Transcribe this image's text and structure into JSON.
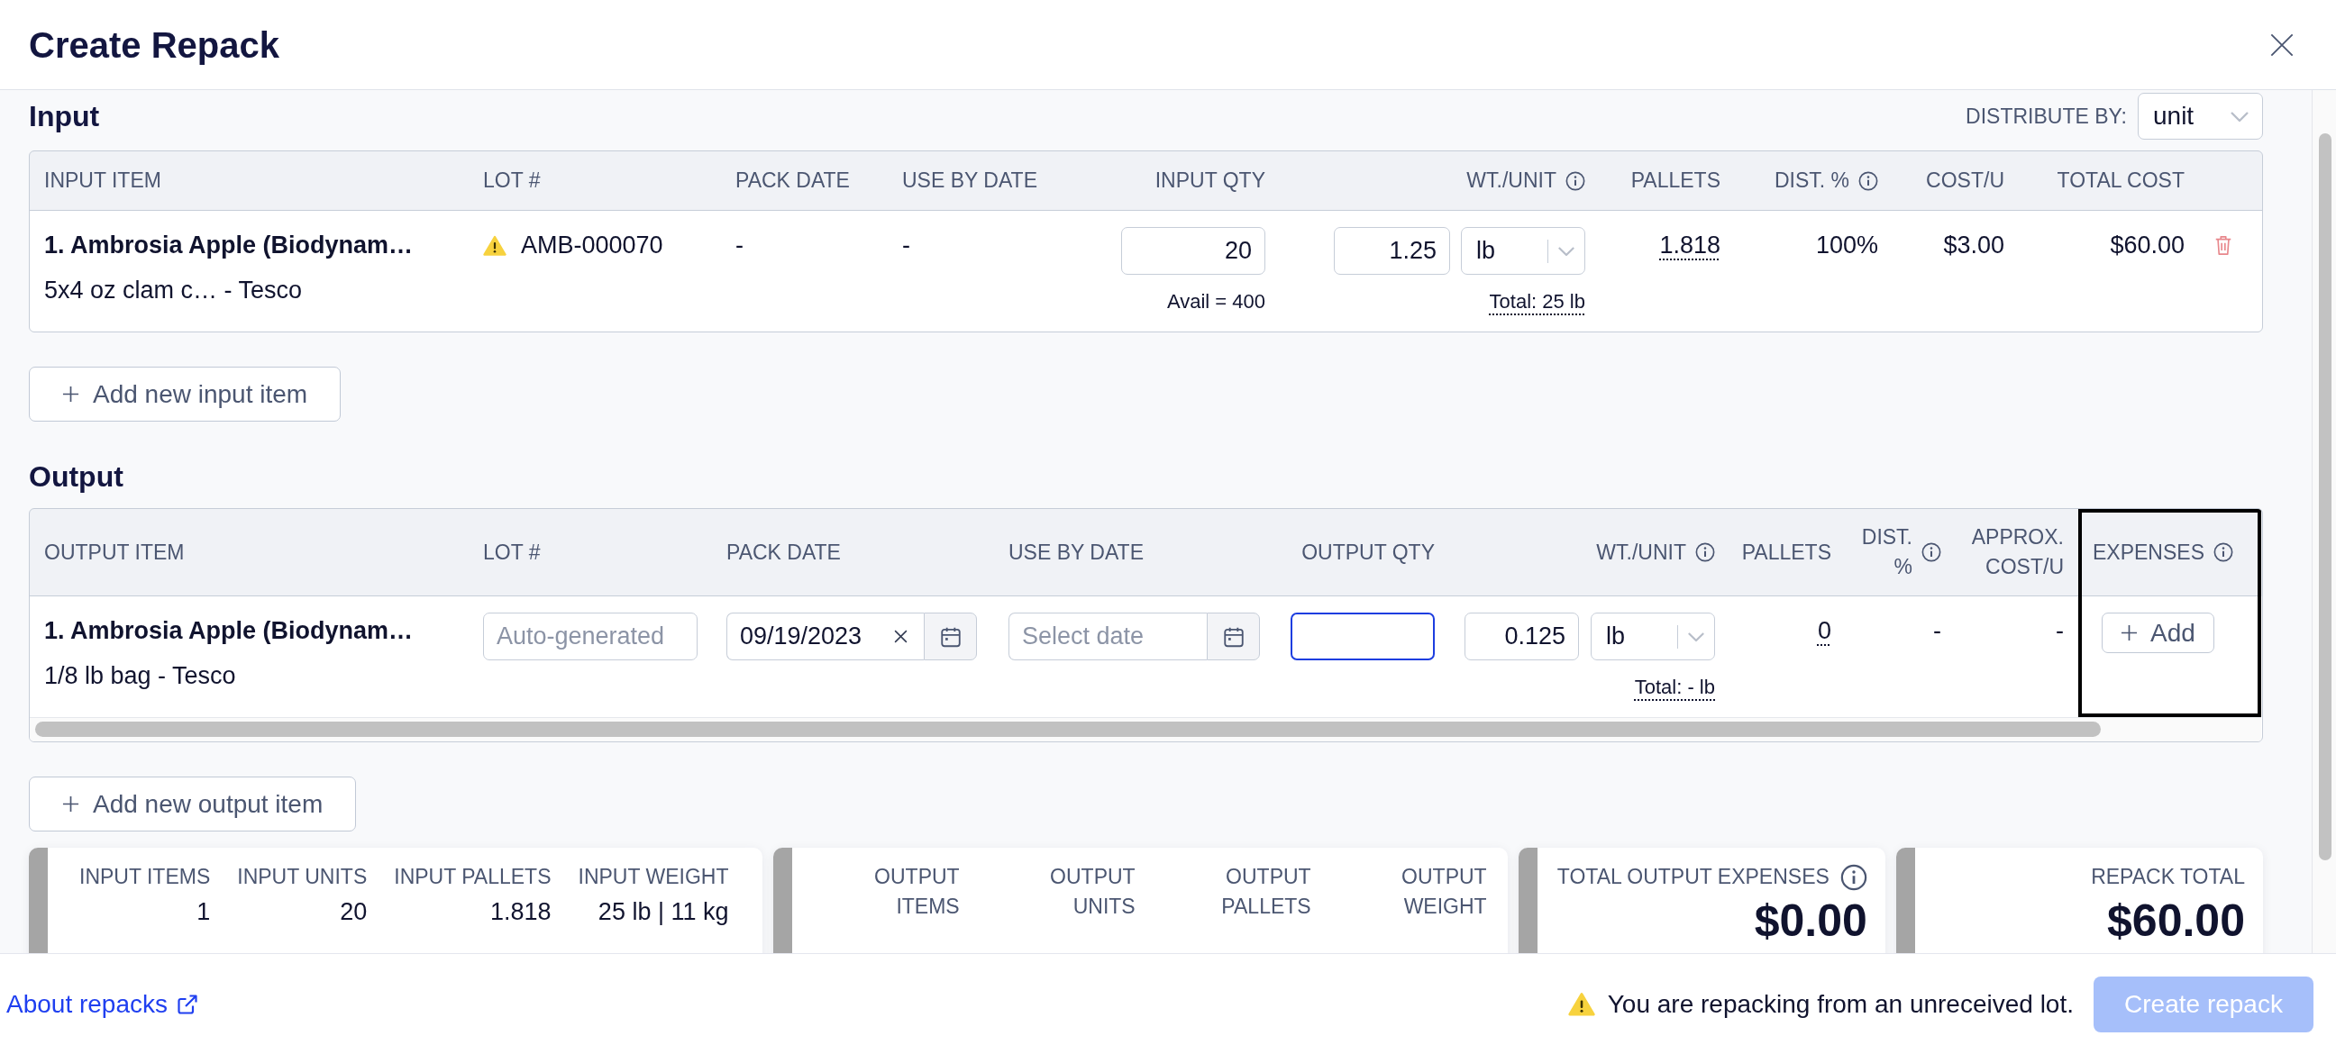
{
  "modal": {
    "title": "Create Repack"
  },
  "input": {
    "heading": "Input",
    "distribute_by": {
      "label": "DISTRIBUTE BY:",
      "value": "unit"
    },
    "columns": [
      {
        "label": "INPUT ITEM",
        "info": false
      },
      {
        "label": "LOT #",
        "info": false
      },
      {
        "label": "PACK DATE",
        "info": false
      },
      {
        "label": "USE BY DATE",
        "info": false
      },
      {
        "label": "INPUT QTY",
        "info": false
      },
      {
        "label": "WT./UNIT",
        "info": true
      },
      {
        "label": "PALLETS",
        "info": false
      },
      {
        "label": "DIST. %",
        "info": true
      },
      {
        "label": "COST/U",
        "info": false
      },
      {
        "label": "TOTAL COST",
        "info": false
      }
    ],
    "rows": [
      {
        "name": "1. Ambrosia Apple (Biodynam…",
        "description": "5x4 oz clam c… - Tesco",
        "lot": "AMB-000070",
        "lot_warning": true,
        "pack_date": "-",
        "use_by_date": "-",
        "quantity": "20",
        "available": "Avail = 400",
        "weight": "1.25",
        "unit": "lb",
        "total_weight": "Total: 25 lb",
        "pallets": "1.818",
        "distribution": "100%",
        "cost_per_unit": "$3.00",
        "total_cost": "$60.00"
      }
    ],
    "add_button": "Add new input item"
  },
  "output": {
    "heading": "Output",
    "columns": [
      {
        "label": "OUTPUT ITEM",
        "info": false,
        "highlighted": false
      },
      {
        "label": "LOT #",
        "info": false,
        "highlighted": false
      },
      {
        "label": "PACK DATE",
        "info": false,
        "highlighted": false
      },
      {
        "label": "USE BY DATE",
        "info": false,
        "highlighted": false
      },
      {
        "label": "OUTPUT QTY",
        "info": false,
        "highlighted": false
      },
      {
        "label": "WT./UNIT",
        "info": true,
        "highlighted": false
      },
      {
        "label": "PALLETS",
        "info": false,
        "highlighted": false
      },
      {
        "label": "DIST. %",
        "info": true,
        "highlighted": false
      },
      {
        "label": "APPROX. COST/U",
        "info": false,
        "highlighted": false
      },
      {
        "label": "EXPENSES",
        "info": true,
        "highlighted": true
      }
    ],
    "rows": [
      {
        "name": "1. Ambrosia Apple (Biodynam…",
        "description": "1/8 lb bag - Tesco",
        "lot": {
          "placeholder": "Auto-generated"
        },
        "pack_date": {
          "value": "09/19/2023"
        },
        "use_by_date": {
          "placeholder": "Select date"
        },
        "quantity": {
          "focused": true
        },
        "weight": "0.125",
        "unit": "lb",
        "total_weight": "Total: - lb",
        "pallets": "0",
        "distribution": "-",
        "approx_cost_per_unit": "-",
        "expenses_button": "Add"
      }
    ],
    "add_button": "Add new output item"
  },
  "summary": [
    {
      "kind": "stats",
      "stats": [
        {
          "label": "INPUT ITEMS",
          "value": "1"
        },
        {
          "label": "INPUT UNITS",
          "value": "20"
        },
        {
          "label": "INPUT PALLETS",
          "value": "1.818"
        },
        {
          "label": "INPUT WEIGHT",
          "value": "25 lb | 11 kg"
        }
      ]
    },
    {
      "kind": "stats",
      "stats": [
        {
          "label": "OUTPUT ITEMS"
        },
        {
          "label": "OUTPUT UNITS"
        },
        {
          "label": "OUTPUT PALLETS"
        },
        {
          "label": "OUTPUT WEIGHT"
        }
      ]
    },
    {
      "kind": "total",
      "label": "TOTAL OUTPUT EXPENSES",
      "info": true,
      "value": "$0.00"
    },
    {
      "kind": "total",
      "label": "REPACK TOTAL",
      "info": false,
      "value": "$60.00"
    }
  ],
  "footer": {
    "link": "About repacks",
    "warning": "You are repacking from an unreceived lot.",
    "create_button": {
      "label": "Create repack",
      "disabled": true
    }
  }
}
